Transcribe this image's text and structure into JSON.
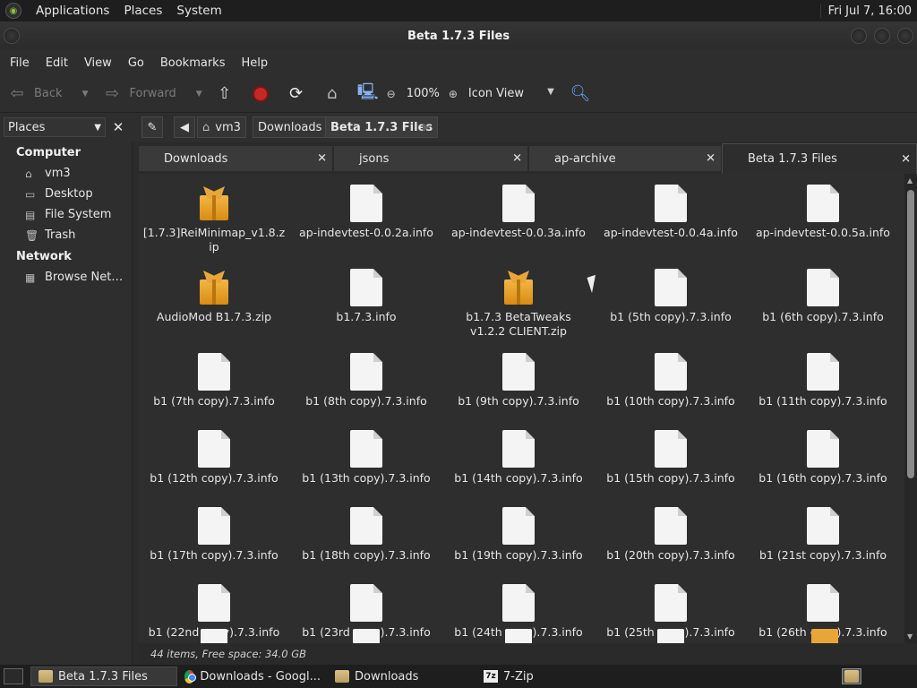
{
  "top_panel": {
    "menus": [
      "Applications",
      "Places",
      "System"
    ],
    "clock": "Fri Jul 7, 16:00"
  },
  "window": {
    "title": "Beta 1.7.3 Files"
  },
  "menubar": [
    "File",
    "Edit",
    "View",
    "Go",
    "Bookmarks",
    "Help"
  ],
  "toolbar": {
    "back_label": "Back",
    "forward_label": "Forward",
    "zoom": "100%",
    "view_mode": "Icon View"
  },
  "location": {
    "sidebar_selector": "Places",
    "crumbs": [
      "vm3",
      "Downloads",
      "Beta 1.7.3 Files"
    ]
  },
  "sidebar": {
    "sections": [
      {
        "title": "Computer",
        "items": [
          "vm3",
          "Desktop",
          "File System",
          "Trash"
        ]
      },
      {
        "title": "Network",
        "items": [
          "Browse Net…"
        ]
      }
    ]
  },
  "tabs": [
    "Downloads",
    "jsons",
    "ap-archive",
    "Beta 1.7.3 Files"
  ],
  "files": [
    {
      "name": "[1.7.3]ReiMinimap_v1.8.zip",
      "type": "zip"
    },
    {
      "name": "ap-indevtest-0.0.2a.info",
      "type": "doc"
    },
    {
      "name": "ap-indevtest-0.0.3a.info",
      "type": "doc"
    },
    {
      "name": "ap-indevtest-0.0.4a.info",
      "type": "doc"
    },
    {
      "name": "ap-indevtest-0.0.5a.info",
      "type": "doc"
    },
    {
      "name": "AudioMod B1.7.3.zip",
      "type": "zip"
    },
    {
      "name": "b1.7.3.info",
      "type": "doc"
    },
    {
      "name": "b1.7.3 BetaTweaks v1.2.2 CLIENT.zip",
      "type": "zip"
    },
    {
      "name": "b1 (5th copy).7.3.info",
      "type": "doc"
    },
    {
      "name": "b1 (6th copy).7.3.info",
      "type": "doc"
    },
    {
      "name": "b1 (7th copy).7.3.info",
      "type": "doc"
    },
    {
      "name": "b1 (8th copy).7.3.info",
      "type": "doc"
    },
    {
      "name": "b1 (9th copy).7.3.info",
      "type": "doc"
    },
    {
      "name": "b1 (10th copy).7.3.info",
      "type": "doc"
    },
    {
      "name": "b1 (11th copy).7.3.info",
      "type": "doc"
    },
    {
      "name": "b1 (12th copy).7.3.info",
      "type": "doc"
    },
    {
      "name": "b1 (13th copy).7.3.info",
      "type": "doc"
    },
    {
      "name": "b1 (14th copy).7.3.info",
      "type": "doc"
    },
    {
      "name": "b1 (15th copy).7.3.info",
      "type": "doc"
    },
    {
      "name": "b1 (16th copy).7.3.info",
      "type": "doc"
    },
    {
      "name": "b1 (17th copy).7.3.info",
      "type": "doc"
    },
    {
      "name": "b1 (18th copy).7.3.info",
      "type": "doc"
    },
    {
      "name": "b1 (19th copy).7.3.info",
      "type": "doc"
    },
    {
      "name": "b1 (20th copy).7.3.info",
      "type": "doc"
    },
    {
      "name": "b1 (21st copy).7.3.info",
      "type": "doc"
    },
    {
      "name": "b1 (22nd copy).7.3.info",
      "type": "doc"
    },
    {
      "name": "b1 (23rd copy).7.3.info",
      "type": "doc"
    },
    {
      "name": "b1 (24th copy).7.3.info",
      "type": "doc"
    },
    {
      "name": "b1 (25th copy).7.3.info",
      "type": "doc"
    },
    {
      "name": "b1 (26th copy).7.3.info",
      "type": "doc"
    }
  ],
  "status": "44 items, Free space: 34.0 GB",
  "taskbar": [
    "Beta 1.7.3 Files",
    "Downloads - Googl...",
    "Downloads",
    "7-Zip"
  ]
}
